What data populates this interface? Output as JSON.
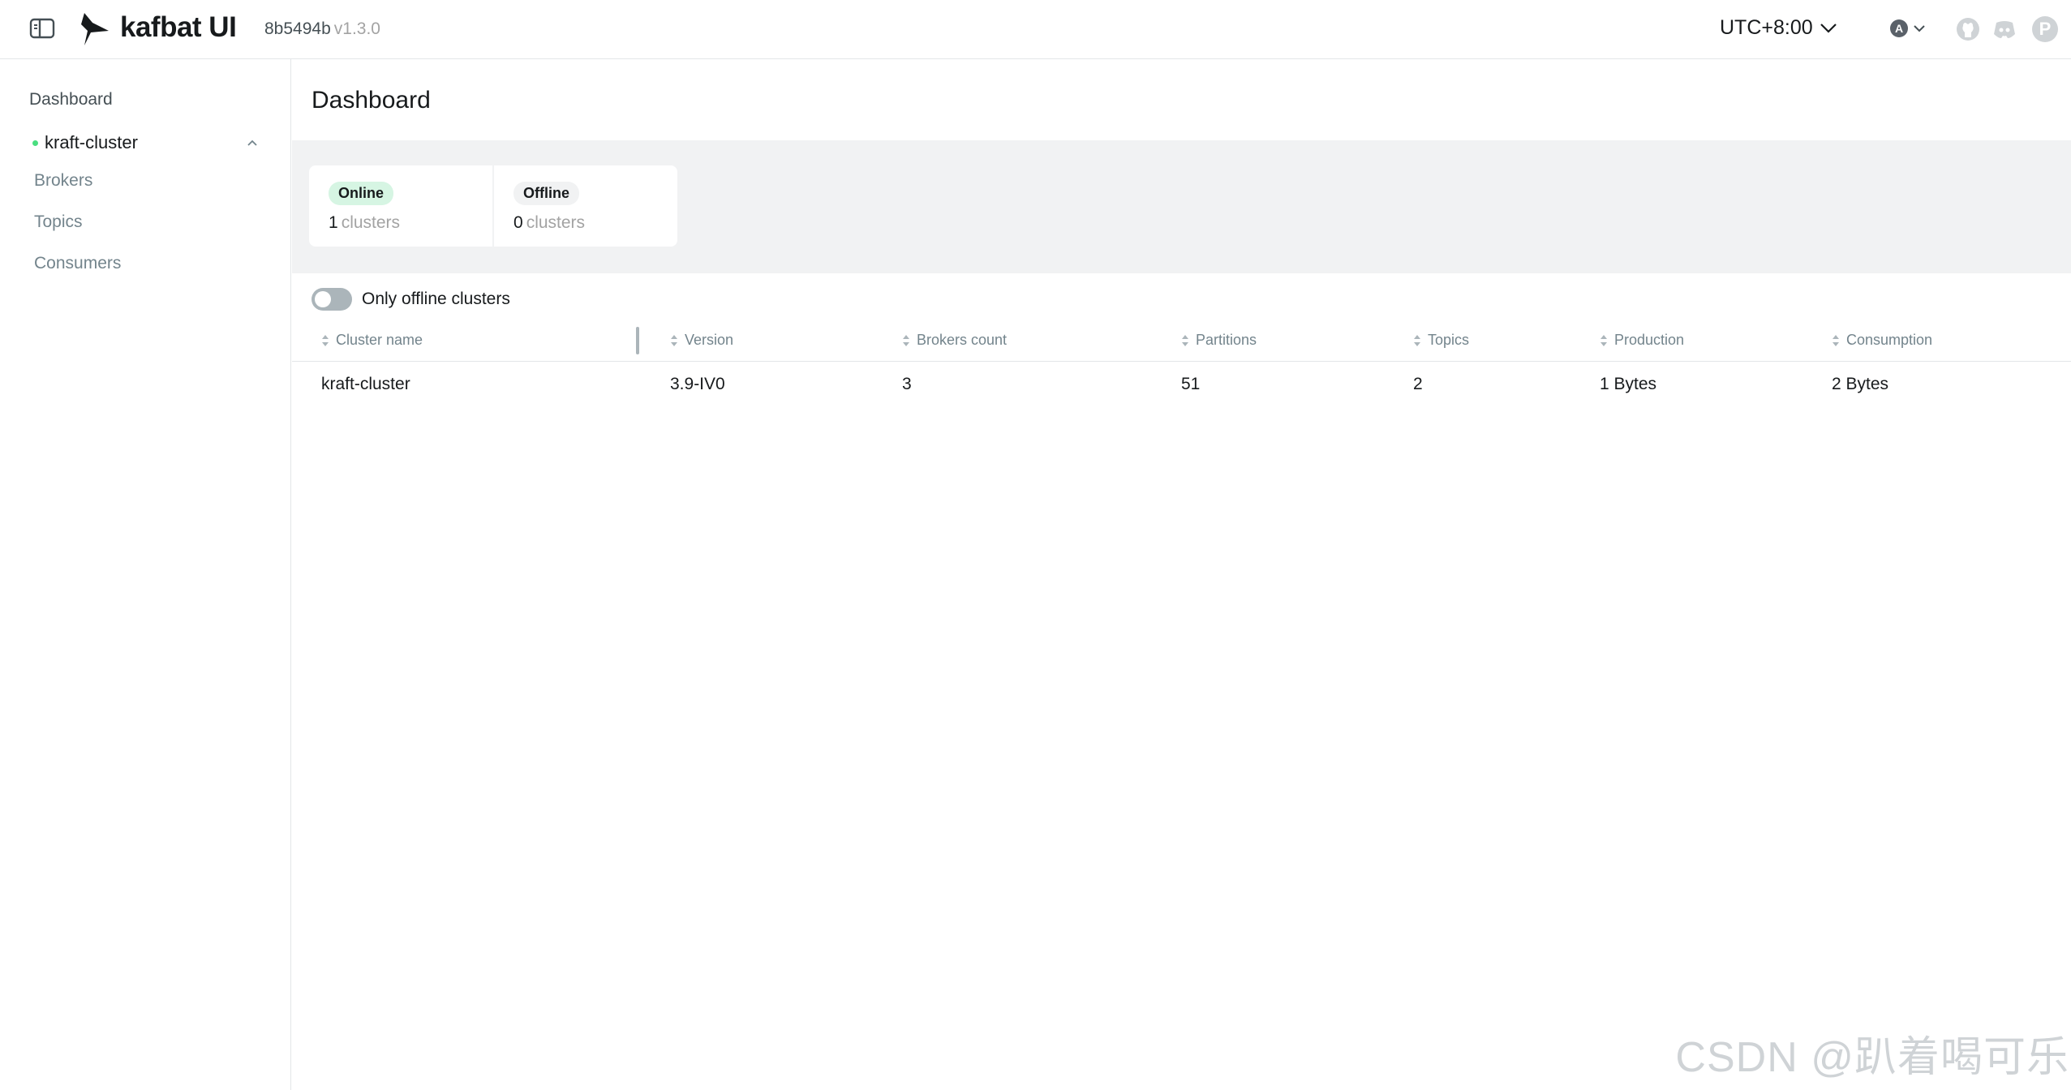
{
  "header": {
    "brand": "kafbat UI",
    "commit": "8b5494b",
    "version": "v1.3.0",
    "timezone": "UTC+8:00",
    "theme_badge": "A",
    "profile_initial": "P"
  },
  "sidebar": {
    "dashboard_label": "Dashboard",
    "cluster": {
      "name": "kraft-cluster",
      "status_color": "#4ade80",
      "items": [
        {
          "label": "Brokers"
        },
        {
          "label": "Topics"
        },
        {
          "label": "Consumers"
        }
      ]
    }
  },
  "main": {
    "title": "Dashboard",
    "stats": {
      "online": {
        "badge": "Online",
        "count": "1",
        "unit": "clusters"
      },
      "offline": {
        "badge": "Offline",
        "count": "0",
        "unit": "clusters"
      }
    },
    "filter": {
      "label": "Only offline clusters",
      "checked": false
    },
    "table": {
      "columns": [
        "Cluster name",
        "Version",
        "Brokers count",
        "Partitions",
        "Topics",
        "Production",
        "Consumption"
      ],
      "rows": [
        [
          "kraft-cluster",
          "3.9-IV0",
          "3",
          "51",
          "2",
          "1 Bytes",
          "2 Bytes"
        ]
      ]
    }
  },
  "watermark": "CSDN @趴着喝可乐"
}
